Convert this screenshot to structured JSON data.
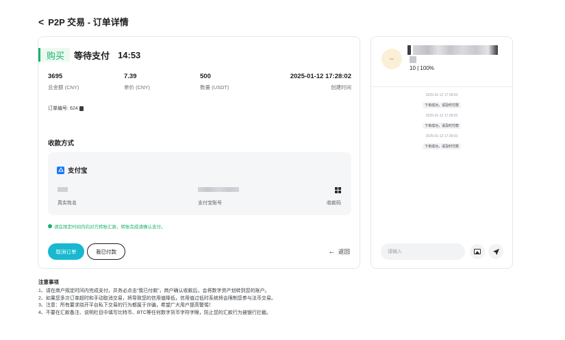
{
  "header": {
    "back": "<",
    "title": "P2P 交易 - 订单详情"
  },
  "order": {
    "side": "购买",
    "status": "等待支付",
    "timer": "14:53",
    "stats": [
      {
        "value": "3695",
        "label": "总金额 (CNY)"
      },
      {
        "value": "7.39",
        "label": "单价 (CNY)"
      },
      {
        "value": "500",
        "label": "数量 (USDT)"
      },
      {
        "value": "2025-01-12 17:28:02",
        "label": "创建时间"
      }
    ],
    "order_no_label": "订单编号:",
    "order_no": "624",
    "payment": {
      "title": "收款方式",
      "method": "支付宝",
      "name_label": "真实姓名",
      "account_label": "支付宝账号",
      "qr_label": "收款码"
    },
    "notice": "请在限定时间内向对方转账汇款，转账完成请确认支付。",
    "cancel_label": "取消订单",
    "paid_label": "我已付款",
    "back_label": "返回"
  },
  "chat": {
    "avatar_letter": "–",
    "rate": "10 | 100%",
    "messages": [
      {
        "time": "2025-01-12 17:28:03",
        "text": "下单成功，请及时付款"
      },
      {
        "time": "2025-01-12 17:28:03",
        "text": "下单成功，请及时付款"
      },
      {
        "time": "2025-01-12 17:28:03",
        "text": "下单成功，请及时付款"
      }
    ],
    "input_placeholder": "请输入"
  },
  "notes": {
    "title": "注意事项",
    "lines": [
      "1、请在商户规定时间内完成支付，并务必点击“我已付款”，商户确认收款后，会将数字资产划转到您的账户。",
      "2、如果您多次订单超时和手动取消交易，将导致您的信用值降低，信用值过低时系统将会限制您参与法币交易。",
      "3、注意：所有要求绕开平台私下交易的行为都属于诈骗，希望广大用户提高警惕！",
      "4、不要在汇款备注、说明栏目中填写比特币、BTC等任何数字货币字符字眼，防止您的汇款行为被银行拦截。"
    ]
  }
}
